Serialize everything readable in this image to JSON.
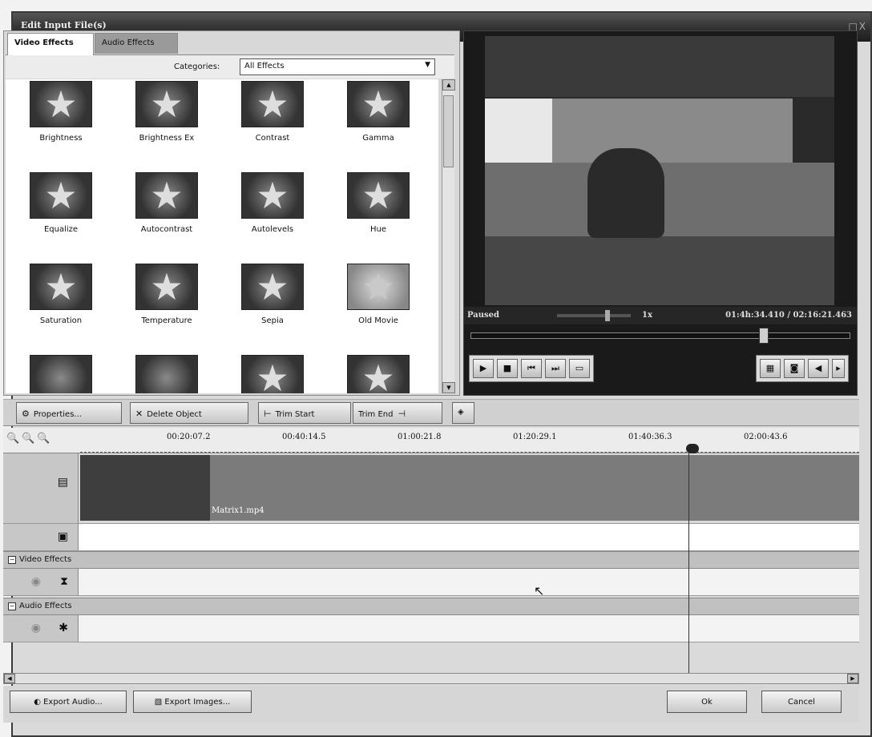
{
  "window": {
    "title": "Edit Input File(s)",
    "controls": "_□X"
  },
  "tabs": [
    {
      "label": "Video Effects",
      "active": true
    },
    {
      "label": "Audio Effects",
      "active": false
    }
  ],
  "categories": {
    "label": "Categories:",
    "selected": "All Effects"
  },
  "effects": [
    {
      "label": "Brightness",
      "icon": "star-icon"
    },
    {
      "label": "Brightness Ex",
      "icon": "star-icon"
    },
    {
      "label": "Contrast",
      "icon": "star-icon"
    },
    {
      "label": "Gamma",
      "icon": "star-icon"
    },
    {
      "label": "Equalize",
      "icon": "star-icon"
    },
    {
      "label": "Autocontrast",
      "icon": "star-icon"
    },
    {
      "label": "Autolevels",
      "icon": "star-icon"
    },
    {
      "label": "Hue",
      "icon": "star-icon"
    },
    {
      "label": "Saturation",
      "icon": "star-icon"
    },
    {
      "label": "Temperature",
      "icon": "star-icon"
    },
    {
      "label": "Sepia",
      "icon": "star-icon"
    },
    {
      "label": "Old Movie",
      "icon": "star-icon"
    }
  ],
  "player": {
    "status": "Paused",
    "speed": "1x",
    "time": "01:4h:34.410 / 02:16:21.463",
    "seek_progress": 0.78
  },
  "toolbar": {
    "properties": "Properties...",
    "delete_object": "Delete Object",
    "trim_start": "Trim Start",
    "trim_end": "Trim End"
  },
  "timeline": {
    "ticks": [
      "00:20:07.2",
      "00:40:14.5",
      "01:00:21.8",
      "01:20:29.1",
      "01:40:36.3",
      "02:00:43.6"
    ],
    "clip_name": "Matrix1.mp4",
    "video_effects": "Video Effects",
    "audio_effects": "Audio Effects"
  },
  "footer": {
    "export_audio": "Export Audio...",
    "export_images": "Export Images...",
    "ok": "Ok",
    "cancel": "Cancel"
  }
}
